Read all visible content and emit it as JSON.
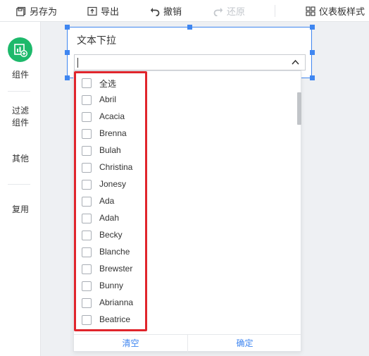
{
  "toolbar": {
    "save_as": "另存为",
    "export": "导出",
    "undo": "撤销",
    "redo": "还原",
    "dashboard_style": "仪表板样式"
  },
  "sidebar": {
    "components": "组件",
    "filter_line1": "过滤",
    "filter_line2": "组件",
    "other": "其他",
    "reuse": "复用"
  },
  "widget": {
    "title": "文本下拉",
    "value": ""
  },
  "dropdown": {
    "items": [
      {
        "label": "全选",
        "checked": false
      },
      {
        "label": "Abril",
        "checked": false
      },
      {
        "label": "Acacia",
        "checked": false
      },
      {
        "label": "Brenna",
        "checked": false
      },
      {
        "label": "Bulah",
        "checked": false
      },
      {
        "label": "Christina",
        "checked": false
      },
      {
        "label": "Jonesy",
        "checked": false
      },
      {
        "label": "Ada",
        "checked": false
      },
      {
        "label": "Adah",
        "checked": false
      },
      {
        "label": "Becky",
        "checked": false
      },
      {
        "label": "Blanche",
        "checked": false
      },
      {
        "label": "Brewster",
        "checked": false
      },
      {
        "label": "Bunny",
        "checked": false
      },
      {
        "label": "Abrianna",
        "checked": false
      },
      {
        "label": "Beatrice",
        "checked": false
      }
    ],
    "clear_label": "清空",
    "confirm_label": "确定"
  },
  "colors": {
    "accent": "#3f86f0",
    "component_green": "#1db96b",
    "highlight_red": "#e0252c"
  }
}
